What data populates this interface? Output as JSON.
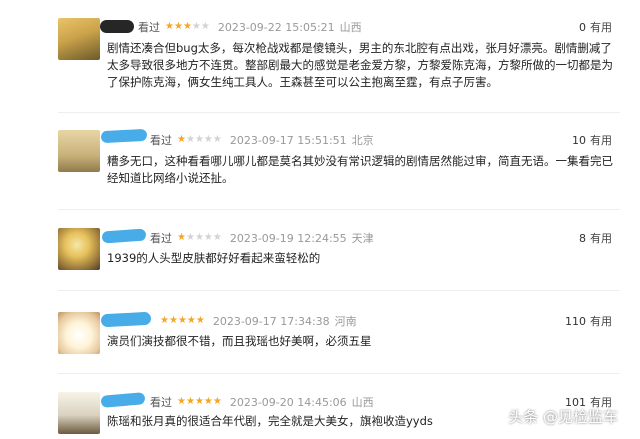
{
  "colors": {
    "star_on": "#f5a623",
    "star_off": "#d3d3d3",
    "meta": "#999999",
    "scribble": "#3da8e6"
  },
  "reviews": [
    {
      "status": "看过",
      "rating": 3,
      "datetime": "2023-09-22 15:05:21",
      "location": "山西",
      "useful_count": "0",
      "useful_label": "有用",
      "content": "剧情还凑合但bug太多，每次枪战戏都是傻镜头，男主的东北腔有点出戏，张月好漂亮。剧情删减了太多导致很多地方不连贯。整部剧最大的感觉是老金爱方黎，方黎爱陈克海，方黎所做的一切都是为了保护陈克海，俩女生纯工具人。王森甚至可以公主抱离至霆，有点子厉害。"
    },
    {
      "status": "看过",
      "rating": 1,
      "datetime": "2023-09-17 15:51:51",
      "location": "北京",
      "useful_count": "10",
      "useful_label": "有用",
      "content": "糟多无口，这种看看哪儿哪儿都是莫名其妙没有常识逻辑的剧情居然能过审，简直无语。一集看完已经知道比网络小说还扯。"
    },
    {
      "status": "看过",
      "rating": 1,
      "datetime": "2023-09-19 12:24:55",
      "location": "天津",
      "useful_count": "8",
      "useful_label": "有用",
      "content": "1939的人头型皮肤都好好看起来蛮轻松的"
    },
    {
      "status": "看过",
      "rating": 5,
      "datetime": "2023-09-17 17:34:38",
      "location": "河南",
      "useful_count": "110",
      "useful_label": "有用",
      "content": "演员们演技都很不错，而且我瑶也好美啊，必须五星"
    },
    {
      "status": "看过",
      "rating": 5,
      "datetime": "2023-09-20 14:45:06",
      "location": "山西",
      "useful_count": "101",
      "useful_label": "有用",
      "content": "陈瑶和张月真的很适合年代剧，完全就是大美女，旗袍收造yyds"
    }
  ],
  "watermark": "头条 @见检监车"
}
